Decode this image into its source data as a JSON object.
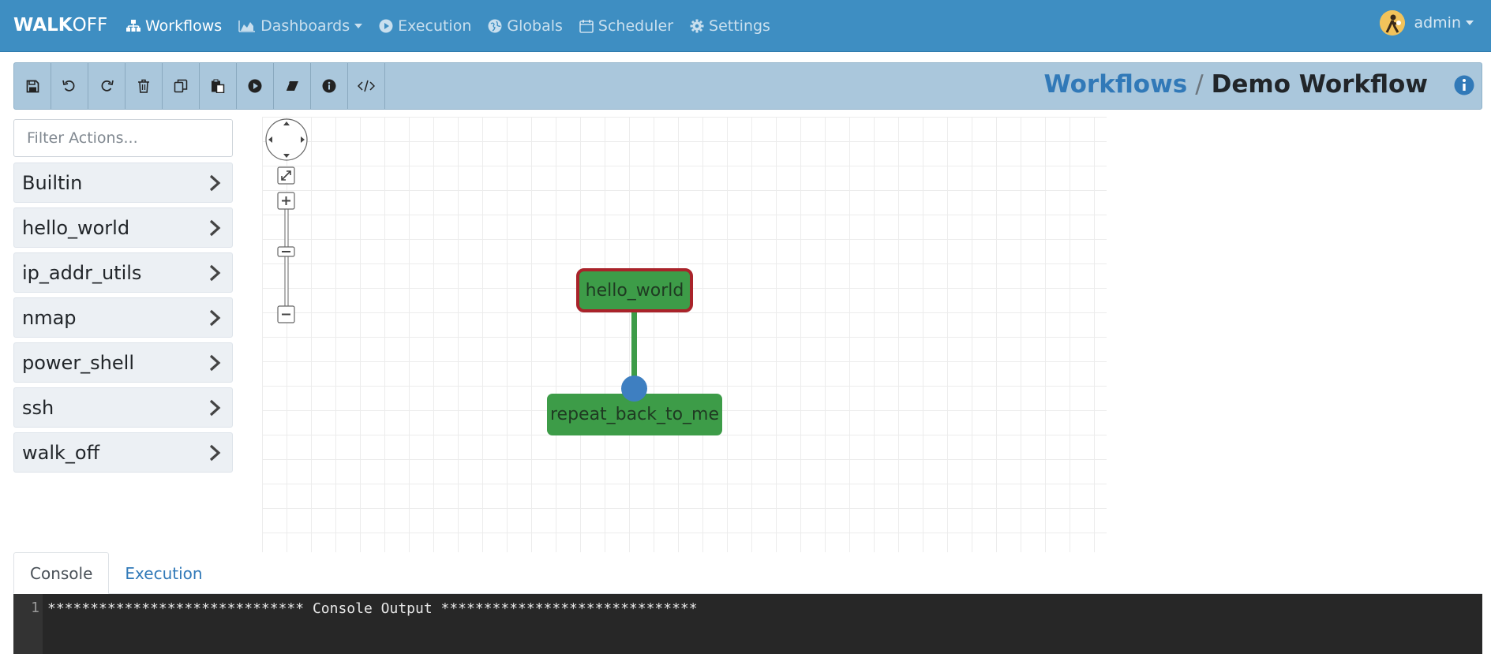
{
  "brand": {
    "bold": "WALK",
    "light": "OFF"
  },
  "nav": {
    "items": [
      {
        "label": "Workflows",
        "icon": "sitemap-icon",
        "active": true,
        "dropdown": false
      },
      {
        "label": "Dashboards",
        "icon": "area-chart-icon",
        "active": false,
        "dropdown": true
      },
      {
        "label": "Execution",
        "icon": "play-circle-icon",
        "active": false,
        "dropdown": false
      },
      {
        "label": "Globals",
        "icon": "globe-icon",
        "active": false,
        "dropdown": false
      },
      {
        "label": "Scheduler",
        "icon": "calendar-icon",
        "active": false,
        "dropdown": false
      },
      {
        "label": "Settings",
        "icon": "gear-icon",
        "active": false,
        "dropdown": false
      }
    ],
    "user": "admin"
  },
  "toolbar": {
    "buttons": [
      "save-icon",
      "undo-icon",
      "redo-icon",
      "trash-icon",
      "copy-icon",
      "paste-icon",
      "play-icon",
      "eraser-icon",
      "info-icon",
      "code-icon"
    ]
  },
  "breadcrumb": {
    "parent": "Workflows",
    "separator": "/",
    "current": "Demo Workflow"
  },
  "sidebar": {
    "filter_placeholder": "Filter Actions...",
    "apps": [
      "Builtin",
      "hello_world",
      "ip_addr_utils",
      "nmap",
      "power_shell",
      "ssh",
      "walk_off"
    ]
  },
  "graph": {
    "nodes": [
      {
        "label": "hello_world",
        "start": true
      },
      {
        "label": "repeat_back_to_me",
        "start": false
      }
    ]
  },
  "tabs": {
    "console": "Console",
    "execution": "Execution"
  },
  "console": {
    "line_number": "1",
    "line": "****************************** Console Output ******************************"
  },
  "colors": {
    "navbar": "#3e8ec2",
    "toolbar": "#aac7dc",
    "node_green": "#3d9c48",
    "start_border": "#a9232a",
    "endpoint_blue": "#3e7fc1",
    "console_bg": "#272727"
  }
}
